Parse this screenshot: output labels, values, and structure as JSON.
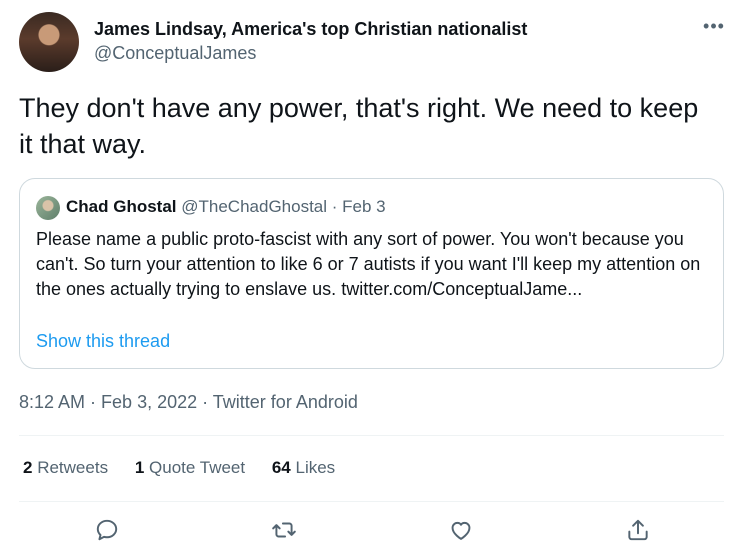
{
  "author": {
    "name": "James Lindsay, America's top Christian nationalist",
    "handle": "@ConceptualJames"
  },
  "tweet": {
    "text": "They don't have any power, that's right. We need to keep it that way."
  },
  "quote": {
    "name": "Chad Ghostal",
    "handle": "@TheChadGhostal",
    "separator": " · ",
    "date": "Feb 3",
    "text": "Please name a public proto-fascist with any sort of power. You won't because you can't. So turn your attention to like 6 or 7 autists if you want I'll keep my attention on the ones actually trying to enslave us.",
    "link": "twitter.com/ConceptualJame...",
    "show_thread": "Show this thread"
  },
  "meta": {
    "time": "8:12 AM",
    "date": "Feb 3, 2022",
    "source": "Twitter for Android",
    "separator": " · "
  },
  "stats": {
    "retweets_count": "2",
    "retweets_label": "Retweets",
    "quotes_count": "1",
    "quotes_label": "Quote Tweet",
    "likes_count": "64",
    "likes_label": "Likes"
  },
  "more_label": "•••",
  "icons": [
    "reply-icon",
    "retweet-icon",
    "like-icon",
    "share-icon"
  ],
  "colors": {
    "link": "#1d9bf0",
    "secondary": "#536471",
    "border": "#cfd9de"
  }
}
